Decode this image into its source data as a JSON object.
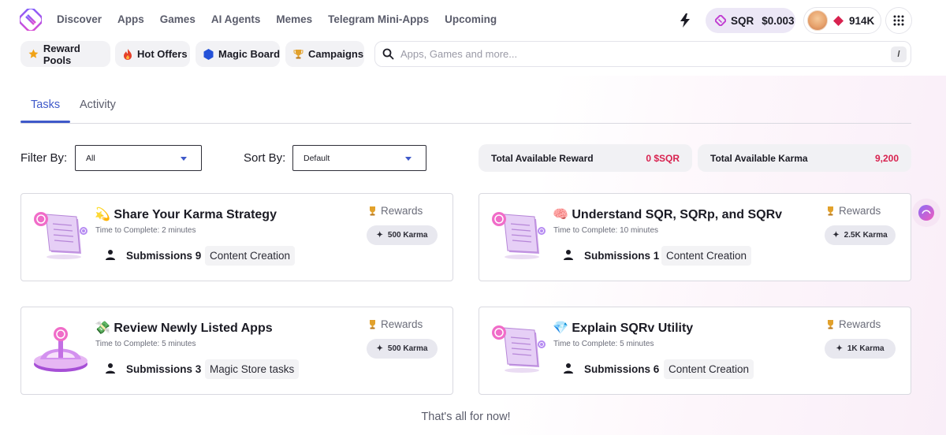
{
  "header": {
    "nav": [
      "Discover",
      "Apps",
      "Games",
      "AI Agents",
      "Memes",
      "Telegram Mini-Apps",
      "Upcoming"
    ],
    "token": {
      "symbol": "SQR",
      "price": "$0.003"
    },
    "karma_balance": "914K"
  },
  "quick_links": [
    "Reward Pools",
    "Hot Offers",
    "Magic Board",
    "Campaigns"
  ],
  "search": {
    "placeholder": "Apps, Games and more...",
    "shortcut": "/"
  },
  "tabs": [
    "Tasks",
    "Activity"
  ],
  "filters": {
    "filter_label": "Filter By:",
    "filter_value": "All",
    "sort_label": "Sort By:",
    "sort_value": "Default"
  },
  "stats": {
    "reward_label": "Total Available Reward",
    "reward_value": "0 $SQR",
    "karma_label": "Total Available Karma",
    "karma_value": "9,200"
  },
  "tasks": [
    {
      "emoji": "💫",
      "title": "Share Your Karma Strategy",
      "time": "Time to Complete: 2 minutes",
      "submissions": "Submissions 9",
      "category": "Content Creation",
      "rewards_label": "Rewards",
      "karma": "500 Karma"
    },
    {
      "emoji": "🧠",
      "title": "Understand SQR, SQRp, and SQRv",
      "time": "Time to Complete: 10 minutes",
      "submissions": "Submissions 1",
      "category": "Content Creation",
      "rewards_label": "Rewards",
      "karma": "2.5K Karma"
    },
    {
      "emoji": "💸",
      "title": "Review Newly Listed Apps",
      "time": "Time to Complete: 5 minutes",
      "submissions": "Submissions 3",
      "category": "Magic Store tasks",
      "rewards_label": "Rewards",
      "karma": "500 Karma"
    },
    {
      "emoji": "💎",
      "title": "Explain SQRv Utility",
      "time": "Time to Complete: 5 minutes",
      "submissions": "Submissions 6",
      "category": "Content Creation",
      "rewards_label": "Rewards",
      "karma": "1K Karma"
    }
  ],
  "footer_text": "That's all for now!",
  "colors": {
    "accent": "#3f59c9",
    "brand": "#c13fd1",
    "highlight": "#d8224f"
  },
  "icons": [
    "logo-icon",
    "bolt-icon",
    "diamond-icon",
    "grid-icon",
    "star-icon",
    "fire-icon",
    "hexagon-icon",
    "trophy-icon",
    "search-icon",
    "person-icon",
    "sparkle-icon"
  ]
}
